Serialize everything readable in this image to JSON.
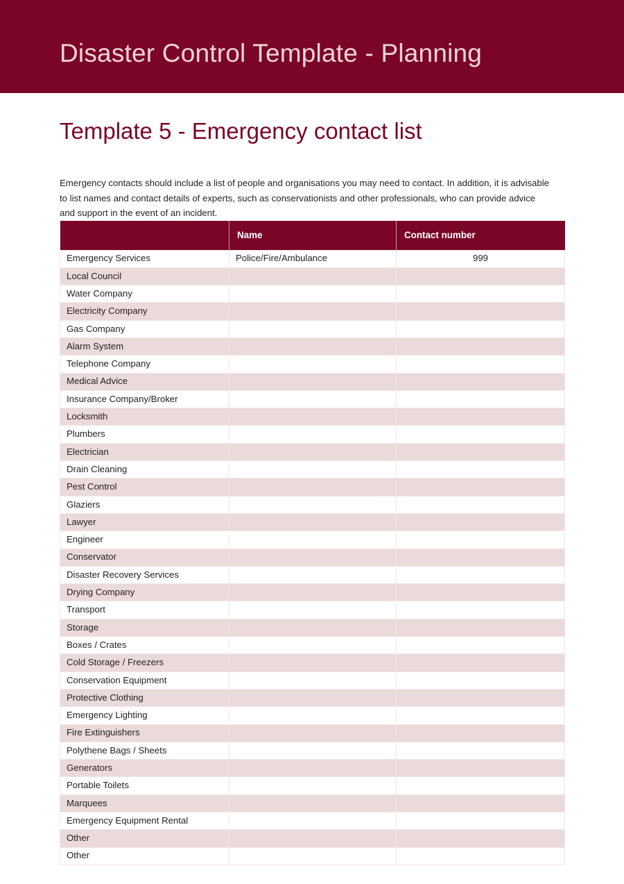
{
  "banner": {
    "title": "Disaster Control Template - Planning",
    "background_color": "#7a0527",
    "text_color": "#f3d3d7"
  },
  "document": {
    "title": "Template 5 - Emergency contact list",
    "title_color": "#7a0527",
    "intro": "Emergency contacts should include a list of people and organisations you may need to contact. In addition, it is advisable to list names and contact details of experts, such as conservationists and other professionals, who can provide advice and support in the event of an incident."
  },
  "table": {
    "header_background": "#7a0527",
    "alt_row_background": "#ebdada",
    "columns": [
      "",
      "Name",
      "Contact number"
    ],
    "rows": [
      {
        "category": "Emergency Services",
        "name": "Police/Fire/Ambulance",
        "number": "999"
      },
      {
        "category": "Local Council",
        "name": "",
        "number": ""
      },
      {
        "category": "Water Company",
        "name": "",
        "number": ""
      },
      {
        "category": "Electricity Company",
        "name": "",
        "number": ""
      },
      {
        "category": "Gas Company",
        "name": "",
        "number": ""
      },
      {
        "category": "Alarm System",
        "name": "",
        "number": ""
      },
      {
        "category": "Telephone Company",
        "name": "",
        "number": ""
      },
      {
        "category": "Medical Advice",
        "name": "",
        "number": ""
      },
      {
        "category": "Insurance Company/Broker",
        "name": "",
        "number": ""
      },
      {
        "category": "Locksmith",
        "name": "",
        "number": ""
      },
      {
        "category": "Plumbers",
        "name": "",
        "number": ""
      },
      {
        "category": "Electrician",
        "name": "",
        "number": ""
      },
      {
        "category": "Drain Cleaning",
        "name": "",
        "number": ""
      },
      {
        "category": "Pest Control",
        "name": "",
        "number": ""
      },
      {
        "category": "Glaziers",
        "name": "",
        "number": ""
      },
      {
        "category": "Lawyer",
        "name": "",
        "number": ""
      },
      {
        "category": "Engineer",
        "name": "",
        "number": ""
      },
      {
        "category": "Conservator",
        "name": "",
        "number": ""
      },
      {
        "category": "Disaster Recovery Services",
        "name": "",
        "number": ""
      },
      {
        "category": "Drying Company",
        "name": "",
        "number": ""
      },
      {
        "category": "Transport",
        "name": "",
        "number": ""
      },
      {
        "category": "Storage",
        "name": "",
        "number": ""
      },
      {
        "category": "Boxes / Crates",
        "name": "",
        "number": ""
      },
      {
        "category": "Cold Storage / Freezers",
        "name": "",
        "number": ""
      },
      {
        "category": "Conservation Equipment",
        "name": "",
        "number": ""
      },
      {
        "category": "Protective Clothing",
        "name": "",
        "number": ""
      },
      {
        "category": "Emergency Lighting",
        "name": "",
        "number": ""
      },
      {
        "category": "Fire Extinguishers",
        "name": "",
        "number": ""
      },
      {
        "category": "Polythene Bags / Sheets",
        "name": "",
        "number": ""
      },
      {
        "category": "Generators",
        "name": "",
        "number": ""
      },
      {
        "category": "Portable Toilets",
        "name": "",
        "number": ""
      },
      {
        "category": "Marquees",
        "name": "",
        "number": ""
      },
      {
        "category": "Emergency Equipment Rental",
        "name": "",
        "number": ""
      },
      {
        "category": "Other",
        "name": "",
        "number": ""
      },
      {
        "category": "Other",
        "name": "",
        "number": ""
      }
    ]
  }
}
